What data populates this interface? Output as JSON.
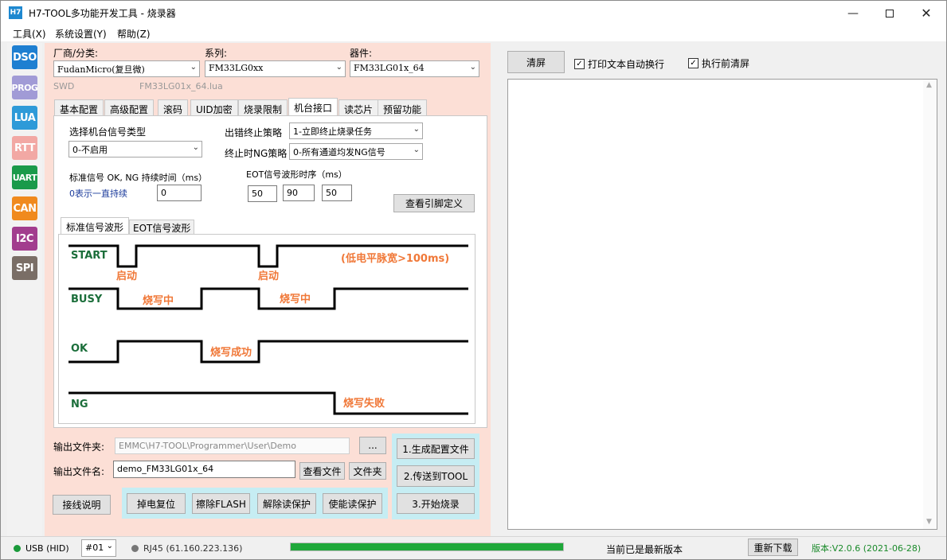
{
  "window": {
    "icon_text": "H7",
    "title": "H7-TOOL多功能开发工具 - 烧录器"
  },
  "menu": [
    "工具(X)",
    "系统设置(Y)",
    "帮助(Z)"
  ],
  "sidebar": [
    {
      "label": "DSO",
      "color": "#1e7fd1"
    },
    {
      "label": "PROG",
      "color": "#a19bd6"
    },
    {
      "label": "LUA",
      "color": "#2e9ad8"
    },
    {
      "label": "RTT",
      "color": "#f2a8a4"
    },
    {
      "label": "UART",
      "color": "#1a9a4a"
    },
    {
      "label": "CAN",
      "color": "#f08a1e"
    },
    {
      "label": "I2C",
      "color": "#a23d8e"
    },
    {
      "label": "SPI",
      "color": "#7a6e66"
    }
  ],
  "device": {
    "vendor_label": "厂商/分类:",
    "vendor_value": "FudanMicro(复旦微)",
    "series_label": "系列:",
    "series_value": "FM33LG0xx",
    "part_label": "器件:",
    "part_value": "FM33LG01x_64",
    "interface": "SWD",
    "lua_file": "FM33LG01x_64.lua"
  },
  "tabs": [
    "基本配置",
    "高级配置",
    "滚码",
    "UID加密",
    "烧录限制",
    "机台接口",
    "读芯片",
    "预留功能"
  ],
  "active_tab": "机台接口",
  "machine": {
    "signal_type_label": "选择机台信号类型",
    "signal_type_value": "0-不启用",
    "error_policy_label": "出错终止策略",
    "error_policy_value": "1-立即终止烧录任务",
    "ng_policy_label": "终止时NG策略",
    "ng_policy_value": "0-所有通道均发NG信号",
    "std_time_label": "标准信号 OK, NG 持续时间（ms）",
    "std_time_hint": "0表示一直持续",
    "std_time_value": "0",
    "eot_label": "EOT信号波形时序（ms）",
    "eot_values": [
      "50",
      "90",
      "50"
    ],
    "pin_button": "查看引脚定义"
  },
  "wave_tabs": [
    "标准信号波形",
    "EOT信号波形"
  ],
  "waveform": {
    "signals": [
      "START",
      "BUSY",
      "OK",
      "NG"
    ],
    "start_note": "启动",
    "pulse_note": "(低电平脉宽>100ms)",
    "busy_note": "烧写中",
    "ok_note": "烧写成功",
    "ng_note": "烧写失败"
  },
  "output": {
    "folder_label": "输出文件夹:",
    "folder_value": "EMMC\\H7-TOOL\\Programmer\\User\\Demo",
    "browse": "...",
    "name_label": "输出文件名:",
    "name_value": "demo_FM33LG01x_64",
    "view_file": "查看文件",
    "open_folder": "文件夹"
  },
  "actions": {
    "gen_config": "1.生成配置文件",
    "send_tool": "2.传送到TOOL",
    "start_burn": "3.开始烧录",
    "wiring": "接线说明",
    "power_reset": "掉电复位",
    "erase_flash": "擦除FLASH",
    "unlock": "解除读保护",
    "lock": "使能读保护"
  },
  "right": {
    "clear": "清屏",
    "wrap_label": "打印文本自动换行",
    "wrap_checked": true,
    "clear_before_label": "执行前清屏",
    "clear_before_checked": true
  },
  "status": {
    "usb": "USB (HID)",
    "usb_color": "#1a9a3a",
    "channel": "#01",
    "rj45": "RJ45 (61.160.223.136)",
    "rj45_color": "#777777",
    "progress": 1.0,
    "progress_color": "#1fa83a",
    "update_text": "当前已是最新版本",
    "redownload": "重新下载",
    "version": "版本:V2.0.6 (2021-06-28)",
    "version_color": "#1a8a2a"
  }
}
